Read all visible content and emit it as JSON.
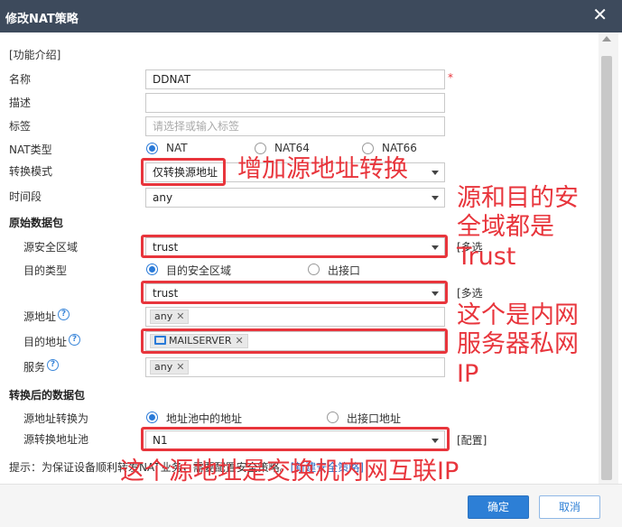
{
  "dialog": {
    "title": "修改NAT策略"
  },
  "intro_link": "[功能介绍]",
  "fields": {
    "name_label": "名称",
    "name_value": "DDNAT",
    "desc_label": "描述",
    "tag_label": "标签",
    "tag_placeholder": "请选择或输入标签",
    "nattype_label": "NAT类型",
    "nattype_options": [
      "NAT",
      "NAT64",
      "NAT66"
    ],
    "mode_label": "转换模式",
    "mode_value": "仅转换源地址",
    "time_label": "时间段",
    "time_value": "any"
  },
  "original": {
    "header": "原始数据包",
    "src_zone_label": "源安全区域",
    "src_zone_value": "trust",
    "dst_type_label": "目的类型",
    "dst_type_options": [
      "目的安全区域",
      "出接口"
    ],
    "dst_zone_value": "trust",
    "multi_link": "[多选",
    "src_addr_label": "源地址",
    "src_addr_tag": "any",
    "dst_addr_label": "目的地址",
    "dst_addr_tag": "MAILSERVER",
    "service_label": "服务",
    "service_tag": "any"
  },
  "translated": {
    "header": "转换后的数据包",
    "src_trans_label": "源地址转换为",
    "src_trans_options": [
      "地址池中的地址",
      "出接口地址"
    ],
    "pool_label": "源转换地址池",
    "pool_value": "N1",
    "config_link": "[配置]"
  },
  "hint": {
    "text": "提示：为保证设备顺利转发NAT业务，需要配置安全策略。",
    "link": "[新建安全策略]"
  },
  "buttons": {
    "ok": "确定",
    "cancel": "取消"
  },
  "annotations": {
    "a1": "增加源地址转换",
    "a2": "源和目的安全域都是Trust",
    "a3": "这个是内网服务器私网IP",
    "a4": "这个源地址是交换机内网互联IP"
  },
  "colors": {
    "titlebar": "#3d4a5c",
    "accent": "#2d7fd6",
    "annotation": "#e8353c"
  }
}
